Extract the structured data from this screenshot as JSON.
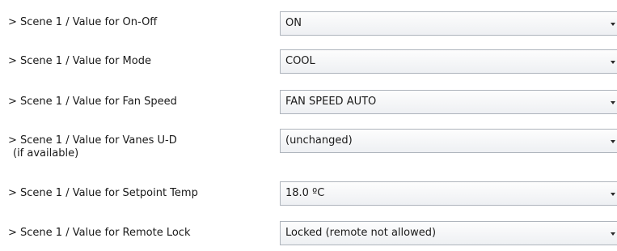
{
  "settings": [
    {
      "label": "> Scene 1 / Value for On-Off",
      "value": "ON",
      "arrow_icon": "chevron-down-icon"
    },
    {
      "label": "> Scene 1 / Value for Mode",
      "value": "COOL",
      "arrow_icon": "chevron-down-icon"
    },
    {
      "label": "> Scene 1 / Value for Fan Speed",
      "value": "FAN SPEED AUTO",
      "arrow_icon": "chevron-down-icon"
    },
    {
      "label": "> Scene 1 / Value for Vanes U-D",
      "sublabel": "(if available)",
      "value": "(unchanged)",
      "arrow_icon": "chevron-down-icon"
    },
    {
      "label": "> Scene 1 / Value for Setpoint Temp",
      "value": "18.0 ºC",
      "arrow_icon": "chevron-down-icon"
    },
    {
      "label": "> Scene 1 / Value for Remote Lock",
      "value": "Locked (remote not allowed)",
      "arrow_icon": "chevron-down-icon"
    }
  ]
}
